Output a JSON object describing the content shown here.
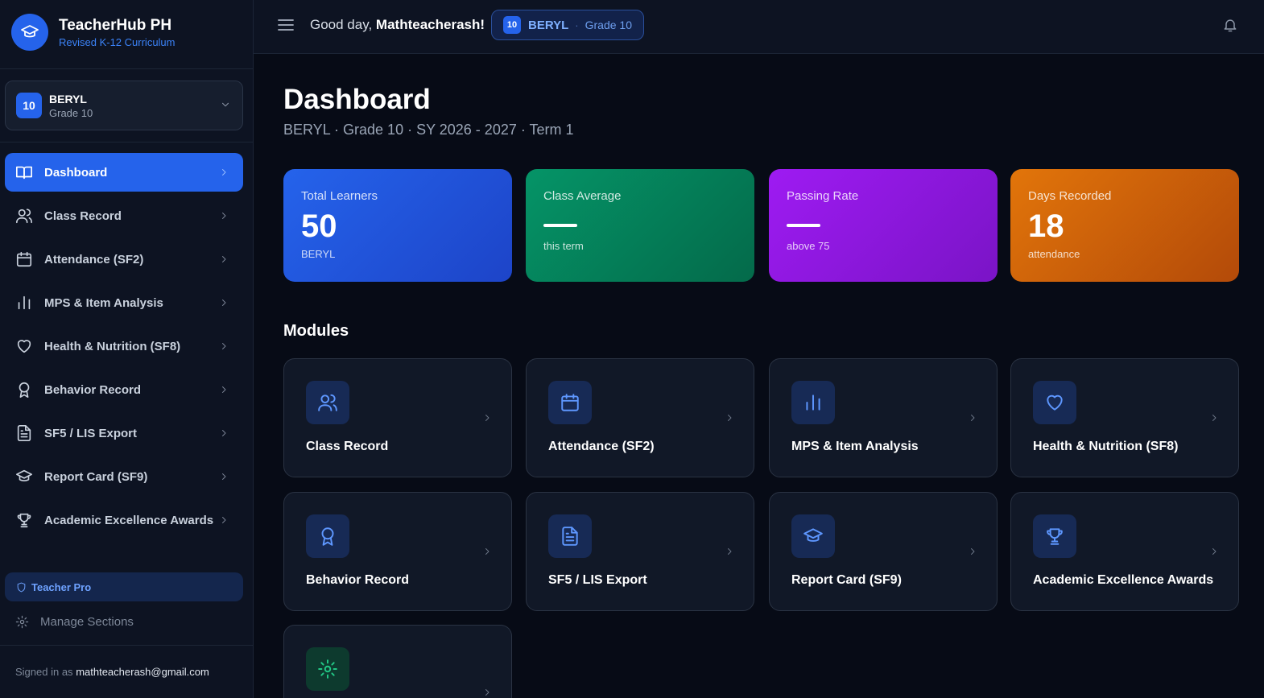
{
  "brand": {
    "title": "TeacherHub PH",
    "subtitle": "Revised K-12 Curriculum"
  },
  "section": {
    "badge": "10",
    "name": "BERYL",
    "grade": "Grade 10"
  },
  "nav": [
    {
      "label": "Dashboard",
      "icon": "book-open-icon",
      "active": true
    },
    {
      "label": "Class Record",
      "icon": "users-icon"
    },
    {
      "label": "Attendance (SF2)",
      "icon": "calendar-icon"
    },
    {
      "label": "MPS & Item Analysis",
      "icon": "bar-chart-icon"
    },
    {
      "label": "Health & Nutrition (SF8)",
      "icon": "heart-icon"
    },
    {
      "label": "Behavior Record",
      "icon": "award-icon"
    },
    {
      "label": "SF5 / LIS Export",
      "icon": "file-text-icon"
    },
    {
      "label": "Report Card (SF9)",
      "icon": "graduation-cap-icon"
    },
    {
      "label": "Academic Excellence Awards",
      "icon": "trophy-icon"
    }
  ],
  "sidebar_footer": {
    "pro_label": "Teacher Pro",
    "manage_label": "Manage Sections",
    "signed_prefix": "Signed in as",
    "email": "mathteacherash@gmail.com"
  },
  "topbar": {
    "greeting_prefix": "Good day,",
    "username": "Mathteacherash!",
    "pill_badge": "10",
    "pill_name": "BERYL",
    "pill_sep": "·",
    "pill_grade": "Grade 10"
  },
  "page": {
    "title": "Dashboard",
    "subtitle": "BERYL · Grade 10 · SY 2026 - 2027 · Term 1"
  },
  "stats": [
    {
      "label": "Total Learners",
      "value": "50",
      "note": "BERYL",
      "color": "#2563eb"
    },
    {
      "label": "Class Average",
      "value": "",
      "note": "this term",
      "color": "#059467"
    },
    {
      "label": "Passing Rate",
      "value": "",
      "note": "above 75",
      "color": "#9e1bf2"
    },
    {
      "label": "Days Recorded",
      "value": "18",
      "note": "attendance",
      "color": "#e2750a"
    }
  ],
  "modules_heading": "Modules",
  "modules": [
    {
      "label": "Class Record",
      "icon": "users-icon"
    },
    {
      "label": "Attendance (SF2)",
      "icon": "calendar-icon"
    },
    {
      "label": "MPS & Item Analysis",
      "icon": "bar-chart-icon"
    },
    {
      "label": "Health & Nutrition (SF8)",
      "icon": "heart-icon"
    },
    {
      "label": "Behavior Record",
      "icon": "award-icon"
    },
    {
      "label": "SF5 / LIS Export",
      "icon": "file-text-icon"
    },
    {
      "label": "Report Card (SF9)",
      "icon": "graduation-cap-icon"
    },
    {
      "label": "Academic Excellence Awards",
      "icon": "trophy-icon"
    },
    {
      "label": "",
      "icon": "gear-icon"
    }
  ]
}
